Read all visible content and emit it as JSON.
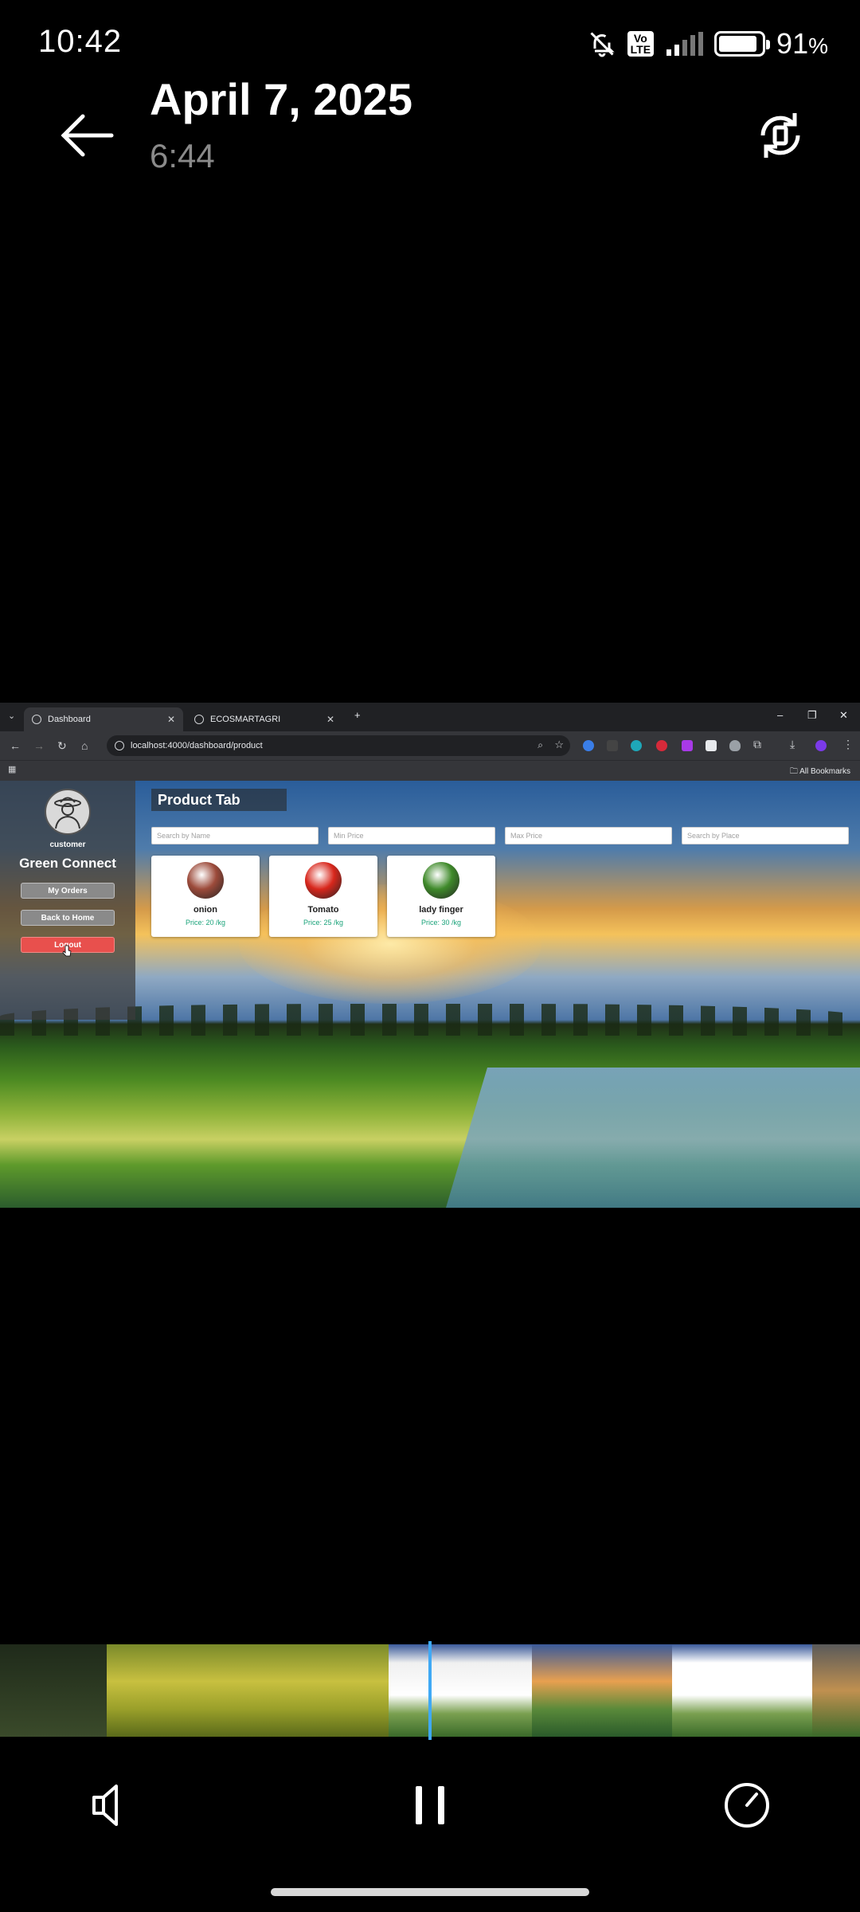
{
  "status_bar": {
    "time": "10:42",
    "battery_percent": "91",
    "battery_unit": "%",
    "battery_level": 0.91,
    "volte": "Vo LTE",
    "icons": [
      "bell-off-icon",
      "volte-icon",
      "signal-icon",
      "battery-icon"
    ]
  },
  "header": {
    "date": "April 7, 2025",
    "time": "6:44",
    "back_icon": "arrow-left-icon",
    "rotate_icon": "rotate-screen-icon"
  },
  "browser": {
    "tabs": [
      {
        "label": "Dashboard",
        "active": true
      },
      {
        "label": "ECOSMARTAGRI",
        "active": false
      }
    ],
    "url": "localhost:4000/dashboard/product",
    "bookmarks_label": "All Bookmarks"
  },
  "app": {
    "sidebar": {
      "role": "customer",
      "brand": "Green Connect",
      "buttons": [
        "My Orders",
        "Back to Home",
        "Logout"
      ]
    },
    "title": "Product Tab",
    "search": {
      "name_placeholder": "Search by Name",
      "min_placeholder": "Min Price",
      "max_placeholder": "Max Price",
      "place_placeholder": "Search by Place"
    },
    "products": [
      {
        "name": "onion",
        "price": "Price: 20 /kg",
        "color": "#9c4a3a"
      },
      {
        "name": "Tomato",
        "price": "Price: 25 /kg",
        "color": "#d8271c"
      },
      {
        "name": "lady finger",
        "price": "Price: 30 /kg",
        "color": "#3f8a2a"
      }
    ]
  },
  "player": {
    "controls": [
      "volume-icon",
      "pause-icon",
      "speed-icon"
    ]
  },
  "colors": {
    "accent": "#3fa9f5",
    "logout": "#e8504d",
    "price_text": "#1aa37a"
  }
}
